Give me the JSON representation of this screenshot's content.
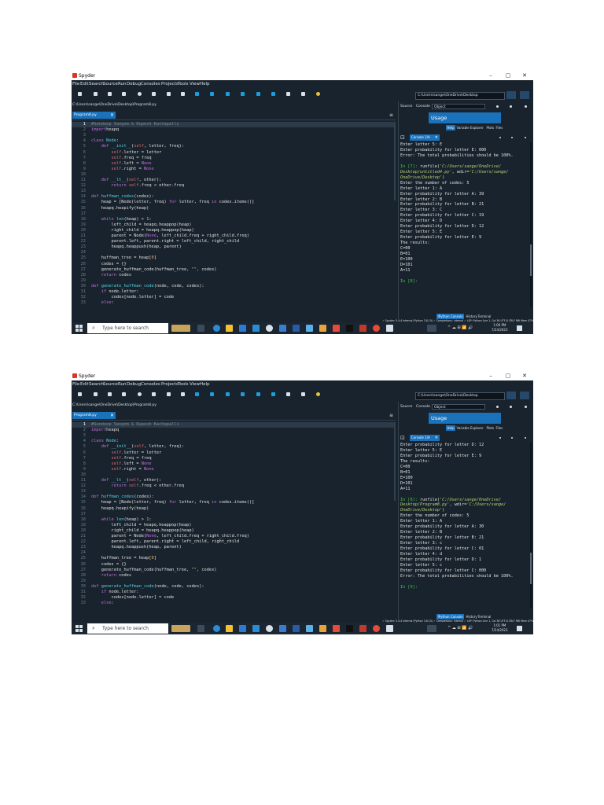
{
  "colors": {
    "accent": "#1a72bb",
    "background": "#19232d",
    "keyword": "#c670e0",
    "function": "#57d6e4",
    "self": "#e06c75",
    "string": "#b4d273",
    "prompt": "#46c446"
  },
  "app": {
    "title": "Spyder",
    "window_buttons": [
      "–",
      "▢",
      "✕"
    ],
    "menus": [
      "File",
      "Edit",
      "Search",
      "Source",
      "Run",
      "Debug",
      "Consoles",
      "Projects",
      "Tools",
      "View",
      "Help"
    ],
    "working_dir": "C:\\Users\\sange\\OneDrive\\Desktop"
  },
  "editor": {
    "file_path": "C:\\Users\\sange\\OneDrive\\Desktop\\Program8.py",
    "tab_label": "Program8.py",
    "tab_close": "✕",
    "menu_icon": "≡"
  },
  "help": {
    "source_label": "Source",
    "source_value": "Console",
    "object_label": "Object",
    "usage_title": "Usage",
    "tabs": [
      "Help",
      "Variable Explorer",
      "Plots",
      "Files"
    ]
  },
  "console": {
    "tab_label": "Console 1/A",
    "tab_close": "✕",
    "bottom_tabs": [
      "IPython Console",
      "History",
      "Terminal"
    ]
  },
  "status_bar": {
    "text": "✓ Spyder: 5.4.4   internal (Python 3.8.10)   ✓ Completions: internal   ✓ LSP: Python   Line 1, Col 36   UTF-8   CRLF   RW   Mem 47%"
  },
  "taskbar": {
    "search_placeholder": "Type here to search",
    "tray": "^ ☁ ⊞ 📶 🔊",
    "shots": [
      {
        "time": "1:00 PM",
        "date": "7/24/2023"
      },
      {
        "time": "1:01 PM",
        "date": "7/24/2023"
      }
    ]
  },
  "code_lines": [
    [
      [
        "cm",
        "#Sandeep Sangem & Rupesh Kachapalli"
      ]
    ],
    [
      [
        "kw",
        "import"
      ],
      [
        "",
        "heapq"
      ]
    ],
    [],
    [
      [
        "kw",
        "class "
      ],
      [
        "fn",
        "Node"
      ],
      [
        "",
        ":"
      ]
    ],
    [
      [
        "",
        "    "
      ],
      [
        "kw",
        "def "
      ],
      [
        "fn",
        "__init__"
      ],
      [
        "",
        "("
      ],
      [
        "sf",
        "self"
      ],
      [
        "",
        ", letter, freq):"
      ]
    ],
    [
      [
        "",
        "        "
      ],
      [
        "sf",
        "self"
      ],
      [
        "",
        ".letter = letter"
      ]
    ],
    [
      [
        "",
        "        "
      ],
      [
        "sf",
        "self"
      ],
      [
        "",
        ".freq = freq"
      ]
    ],
    [
      [
        "",
        "        "
      ],
      [
        "sf",
        "self"
      ],
      [
        "",
        ".left = "
      ],
      [
        "kw",
        "None"
      ]
    ],
    [
      [
        "",
        "        "
      ],
      [
        "sf",
        "self"
      ],
      [
        "",
        ".right = "
      ],
      [
        "kw",
        "None"
      ]
    ],
    [],
    [
      [
        "",
        "    "
      ],
      [
        "kw",
        "def "
      ],
      [
        "fn",
        "__lt__"
      ],
      [
        "",
        "("
      ],
      [
        "sf",
        "self"
      ],
      [
        "",
        ", other):"
      ]
    ],
    [
      [
        "",
        "        "
      ],
      [
        "kw",
        "return "
      ],
      [
        "sf",
        "self"
      ],
      [
        "",
        ".freq < other.freq"
      ]
    ],
    [],
    [
      [
        "kw",
        "def "
      ],
      [
        "fn",
        "huffman_codes"
      ],
      [
        "",
        "(codes):"
      ]
    ],
    [
      [
        "",
        "    heap = [Node(letter, freq) "
      ],
      [
        "kw",
        "for"
      ],
      [
        "",
        " letter, freq "
      ],
      [
        "kw",
        "in"
      ],
      [
        "",
        " codes.items()]"
      ]
    ],
    [
      [
        "",
        "    heapq.heapify(heap)"
      ]
    ],
    [],
    [
      [
        "",
        "    "
      ],
      [
        "kw",
        "while "
      ],
      [
        "fn",
        "len"
      ],
      [
        "",
        "(heap) > "
      ],
      [
        "num",
        "1"
      ],
      [
        "",
        ":"
      ]
    ],
    [
      [
        "",
        "        left_child = heapq.heappop(heap)"
      ]
    ],
    [
      [
        "",
        "        right_child = heapq.heappop(heap)"
      ]
    ],
    [
      [
        "",
        "        parent = Node("
      ],
      [
        "kw",
        "None"
      ],
      [
        "",
        ", left_child.freq + right_child.freq)"
      ]
    ],
    [
      [
        "",
        "        parent.left, parent.right = left_child, right_child"
      ]
    ],
    [
      [
        "",
        "        heapq.heappush(heap, parent)"
      ]
    ],
    [],
    [
      [
        "",
        "    huffman_tree = heap["
      ],
      [
        "num",
        "0"
      ],
      [
        "",
        "]"
      ]
    ],
    [
      [
        "",
        "    codes = {}"
      ]
    ],
    [
      [
        "",
        "    generate_huffman_code(huffman_tree, "
      ],
      [
        "str",
        "\"\""
      ],
      [
        "",
        ", codes)"
      ]
    ],
    [
      [
        "",
        "    "
      ],
      [
        "kw",
        "return"
      ],
      [
        "",
        " codes"
      ]
    ],
    [],
    [
      [
        "kw",
        "def "
      ],
      [
        "fn",
        "generate_huffman_code"
      ],
      [
        "",
        "(node, code, codes):"
      ]
    ],
    [
      [
        "",
        "    "
      ],
      [
        "kw",
        "if"
      ],
      [
        "",
        " node.letter:"
      ]
    ],
    [
      [
        "",
        "        codes[node.letter] = code"
      ]
    ],
    [
      [
        "",
        "    "
      ],
      [
        "kw",
        "else"
      ],
      [
        "",
        ":"
      ]
    ]
  ],
  "console_output": [
    [
      [
        [
          "",
          "Enter letter 5: E"
        ]
      ],
      [
        [
          "",
          "Enter probability for letter E: 000"
        ]
      ],
      [
        [
          "",
          "Error: The total probabilities should be 100%."
        ]
      ],
      [],
      [
        [
          "prompt",
          "In [7]:"
        ],
        [
          "",
          " runfile("
        ],
        [
          "cstr",
          "'C:/Users/sange/OneDrive/"
        ]
      ],
      [
        [
          "cstr",
          "Desktop/untitled4.py'"
        ],
        [
          "",
          ", wdir="
        ],
        [
          "cstr",
          "'C:/Users/sange/"
        ]
      ],
      [
        [
          "cstr",
          "OneDrive/Desktop'"
        ],
        [
          "",
          ")"
        ]
      ],
      [
        [
          "",
          "Enter the number of codes: 5"
        ]
      ],
      [
        [
          "",
          "Enter letter 1: A"
        ]
      ],
      [
        [
          "",
          "Enter probability for letter A: 39"
        ]
      ],
      [
        [
          "",
          "Enter letter 2: B"
        ]
      ],
      [
        [
          "",
          "Enter probability for letter B: 21"
        ]
      ],
      [
        [
          "",
          "Enter letter 3: C"
        ]
      ],
      [
        [
          "",
          "Enter probability for letter C: 19"
        ]
      ],
      [
        [
          "",
          "Enter letter 4: D"
        ]
      ],
      [
        [
          "",
          "Enter probability for letter D: 12"
        ]
      ],
      [
        [
          "",
          "Enter letter 5: E"
        ]
      ],
      [
        [
          "",
          "Enter probability for letter E: 9"
        ]
      ],
      [
        [
          "",
          "The results:"
        ]
      ],
      [
        [
          "",
          "C=00"
        ]
      ],
      [
        [
          "",
          "B=01"
        ]
      ],
      [
        [
          "",
          "E=100"
        ]
      ],
      [
        [
          "",
          "D=101"
        ]
      ],
      [
        [
          "",
          "A=11"
        ]
      ],
      [],
      [
        [
          "prompt",
          "In [8]:"
        ]
      ]
    ],
    [
      [
        [
          "",
          "Enter probability for letter D: 12"
        ]
      ],
      [
        [
          "",
          "Enter letter 5: E"
        ]
      ],
      [
        [
          "",
          "Enter probability for letter E: 9"
        ]
      ],
      [
        [
          "",
          "The results:"
        ]
      ],
      [
        [
          "",
          "C=00"
        ]
      ],
      [
        [
          "",
          "B=01"
        ]
      ],
      [
        [
          "",
          "E=100"
        ]
      ],
      [
        [
          "",
          "D=101"
        ]
      ],
      [
        [
          "",
          "A=11"
        ]
      ],
      [],
      [
        [
          "prompt",
          "In [8]:"
        ],
        [
          "",
          " runfile("
        ],
        [
          "cstr",
          "'C:/Users/sange/OneDrive/"
        ]
      ],
      [
        [
          "cstr",
          "Desktop/Program8.py'"
        ],
        [
          "",
          ", wdir="
        ],
        [
          "cstr",
          "'C:/Users/sange/"
        ]
      ],
      [
        [
          "cstr",
          "OneDrive/Desktop'"
        ],
        [
          "",
          ")"
        ]
      ],
      [
        [
          "",
          "Enter the number of codes: 5"
        ]
      ],
      [
        [
          "",
          "Enter letter 1: A"
        ]
      ],
      [
        [
          "",
          "Enter probability for letter A: 30"
        ]
      ],
      [
        [
          "",
          "Enter letter 2: B"
        ]
      ],
      [
        [
          "",
          "Enter probability for letter B: 21"
        ]
      ],
      [
        [
          "",
          "Enter letter 3: c"
        ]
      ],
      [
        [
          "",
          "Enter probability for letter C: 01"
        ]
      ],
      [
        [
          "",
          "Enter letter 4: d"
        ]
      ],
      [
        [
          "",
          "Enter probability for letter D: 1"
        ]
      ],
      [
        [
          "",
          "Enter letter 5: c"
        ]
      ],
      [
        [
          "",
          "Enter probability for letter C: 000"
        ]
      ],
      [
        [
          "",
          "Error: The total probabilities should be 100%."
        ]
      ],
      [],
      [
        [
          "prompt",
          "In [9]:"
        ]
      ]
    ]
  ]
}
